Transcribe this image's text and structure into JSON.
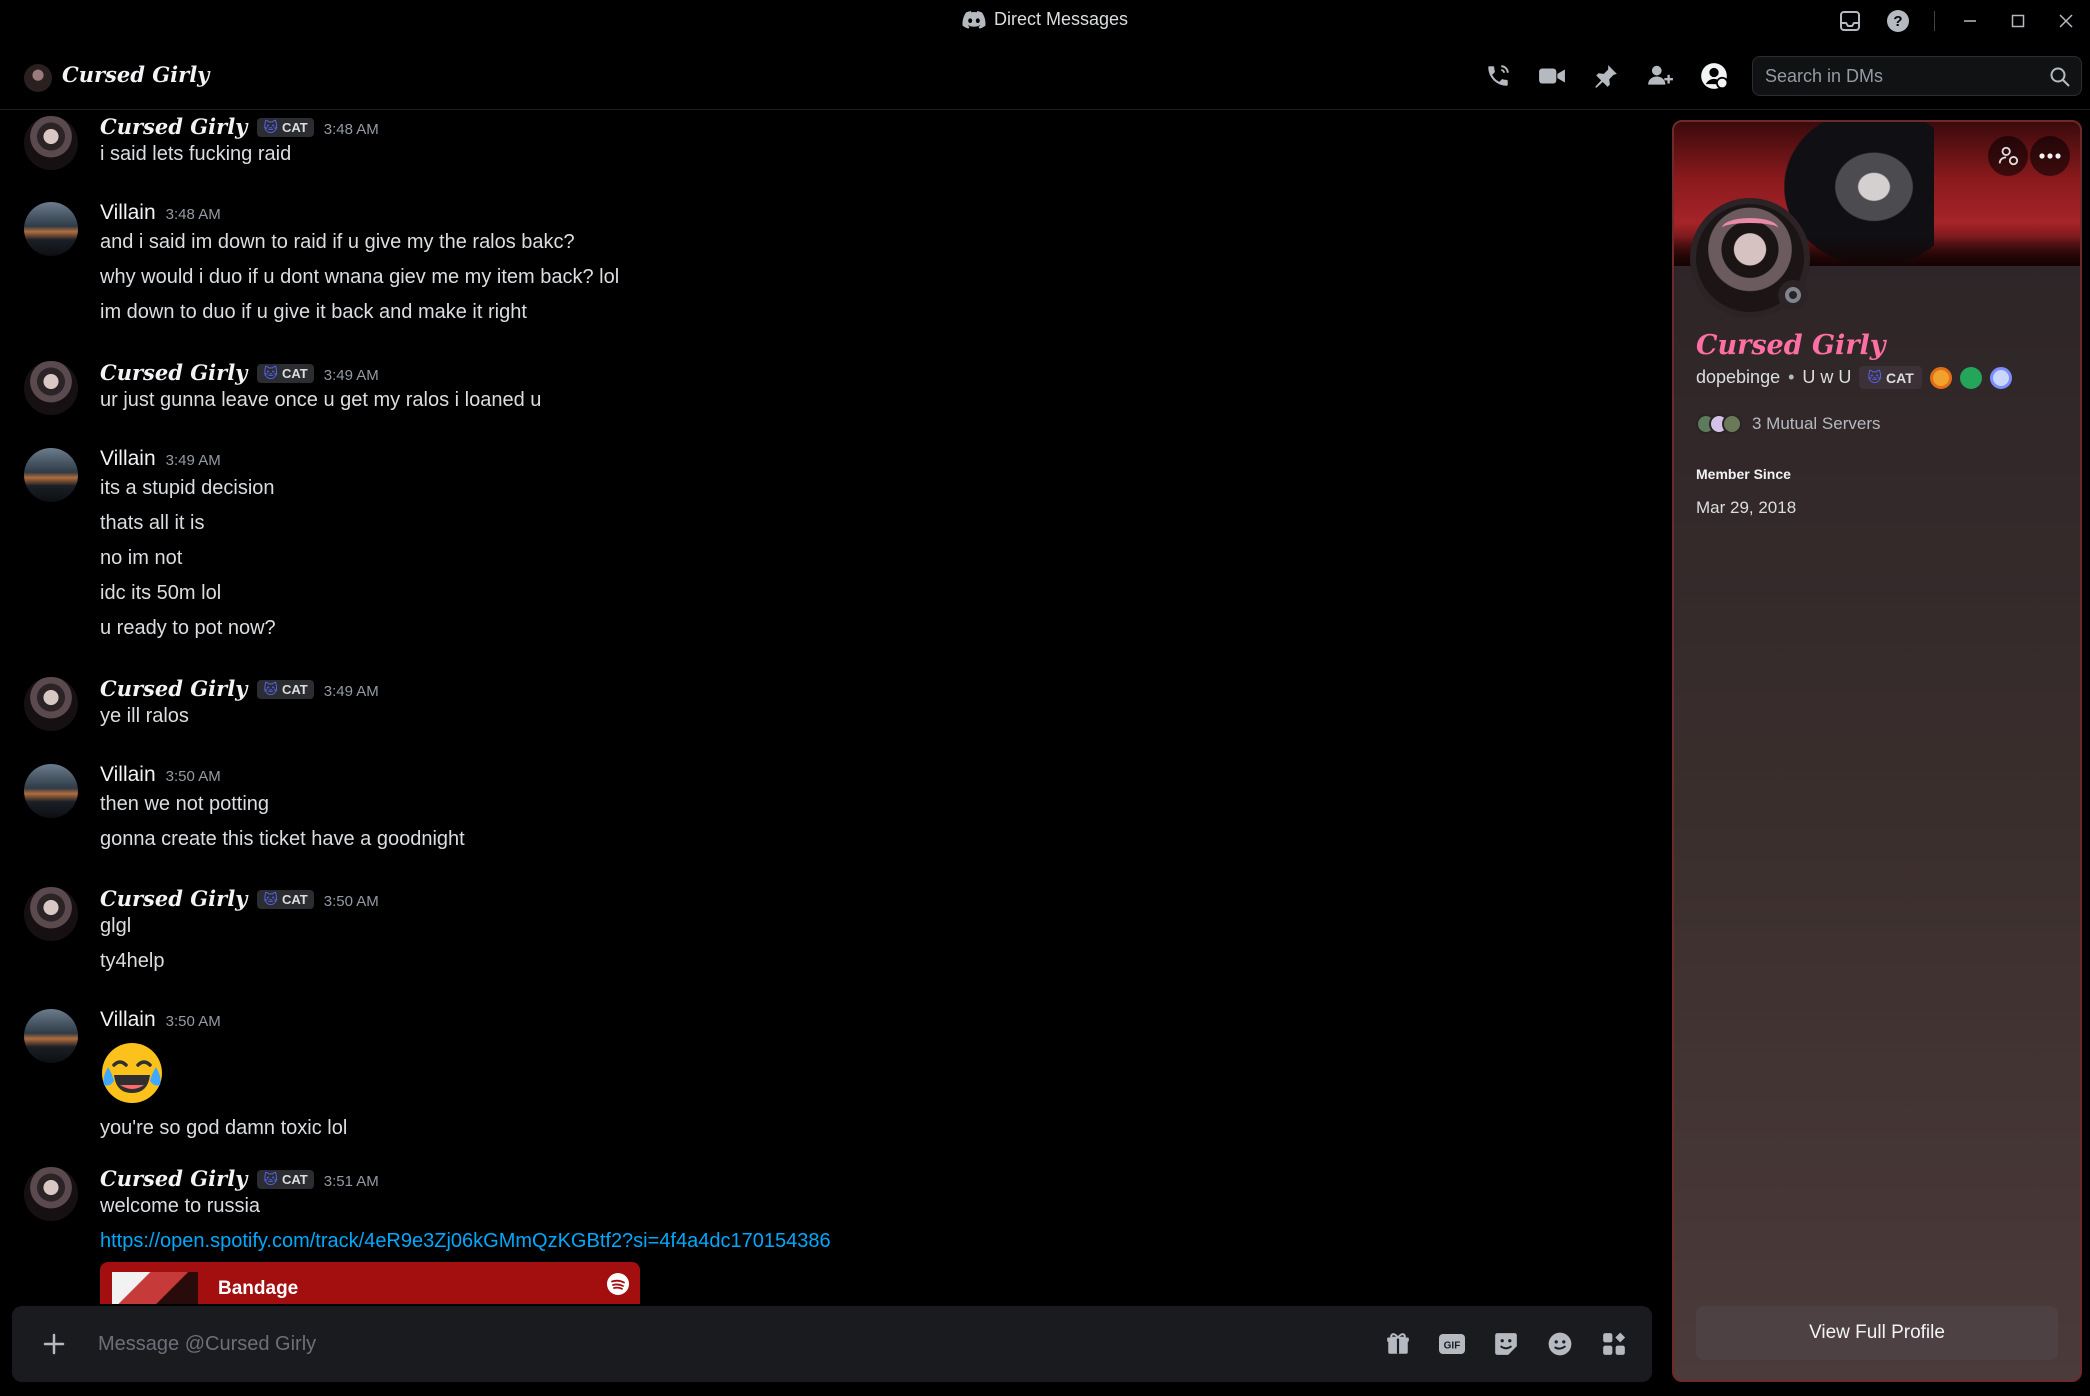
{
  "titlebar": {
    "title": "Direct Messages"
  },
  "header": {
    "channel_name": "Cursed Girly"
  },
  "search": {
    "placeholder": "Search in DMs"
  },
  "tag_label": "CAT",
  "messages": [
    {
      "author": "Cursed Girly",
      "time": "3:48 AM",
      "lines": [
        "i said lets fucking raid"
      ]
    },
    {
      "author": "Villain",
      "time": "3:48 AM",
      "lines": [
        "and i said im down to raid if u give my the ralos bakc?",
        "why would i duo if u dont wnana giev me my item back? lol",
        "im down to duo if u give it back and make it right"
      ]
    },
    {
      "author": "Cursed Girly",
      "time": "3:49 AM",
      "lines": [
        "ur just gunna leave once u get my ralos i loaned u"
      ]
    },
    {
      "author": "Villain",
      "time": "3:49 AM",
      "lines": [
        "its a stupid decision",
        "thats all it is",
        "no im not",
        "idc its 50m lol",
        "u ready to pot now?"
      ]
    },
    {
      "author": "Cursed Girly",
      "time": "3:49 AM",
      "lines": [
        "ye ill ralos"
      ]
    },
    {
      "author": "Villain",
      "time": "3:50 AM",
      "lines": [
        "then we not potting",
        "gonna create this ticket have a goodnight"
      ]
    },
    {
      "author": "Cursed Girly",
      "time": "3:50 AM",
      "lines": [
        "glgl",
        "ty4help"
      ]
    },
    {
      "author": "Villain",
      "time": "3:50 AM",
      "lines": [
        "you're so god damn toxic lol"
      ]
    },
    {
      "author": "Cursed Girly",
      "time": "3:51 AM",
      "lines": [
        "welcome to russia"
      ],
      "link": "https://open.spotify.com/track/4eR9e3Zj06kGMmQzKGBtf2?si=4f4a4dc170154386",
      "embed_title": "Bandage"
    }
  ],
  "composer": {
    "placeholder": "Message @Cursed Girly"
  },
  "profile": {
    "display_name": "Cursed Girly",
    "username": "dopebinge",
    "pronouns": "U w U",
    "mutual_servers": "3 Mutual Servers",
    "member_since_label": "Member Since",
    "member_since": "Mar 29, 2018",
    "view_full_profile": "View Full Profile"
  },
  "colors": {
    "accent": "#5865f2",
    "link": "#00a8fc",
    "profile_name": "#ff6fa3",
    "embed": "#a30e0e",
    "spotify": "#ffffff"
  }
}
